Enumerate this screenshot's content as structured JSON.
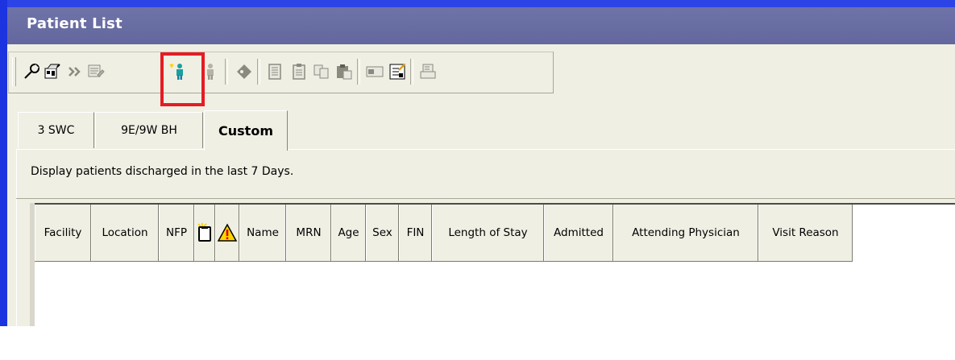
{
  "window": {
    "title": "Patient List"
  },
  "toolbar": {
    "buttons": [
      {
        "name": "properties-wrench-icon"
      },
      {
        "name": "list-settings-icon"
      },
      {
        "name": "more-chevrons-icon"
      },
      {
        "name": "document-edit-icon"
      },
      {
        "name": "add-patient-icon"
      },
      {
        "name": "remove-patient-icon"
      },
      {
        "name": "tag-icon"
      },
      {
        "name": "notepad-icon"
      },
      {
        "name": "clipboard-icon"
      },
      {
        "name": "copy-icon"
      },
      {
        "name": "paste-icon"
      },
      {
        "name": "card-icon"
      },
      {
        "name": "checklist-icon"
      },
      {
        "name": "print-icon"
      }
    ]
  },
  "tabs": [
    {
      "label": "3 SWC"
    },
    {
      "label": "9E/9W BH"
    },
    {
      "label": "Custom",
      "active": true
    }
  ],
  "description": "Display patients discharged in the last 7 Days.",
  "grid": {
    "columns": [
      "Facility",
      "Location",
      "NFP",
      "",
      "",
      "Name",
      "MRN",
      "Age",
      "Sex",
      "FIN",
      "Length of Stay",
      "Admitted",
      "Attending Physician",
      "Visit Reason"
    ],
    "rows": []
  },
  "colors": {
    "highlight": "#e51c23",
    "titlebar": "#63679d",
    "window_border": "#1c33e0"
  }
}
